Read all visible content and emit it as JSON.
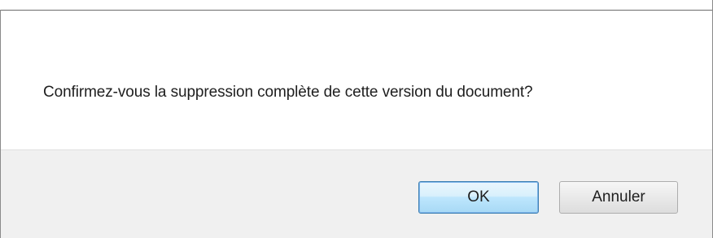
{
  "dialog": {
    "message": "Confirmez-vous la suppression complète de cette version du document?",
    "buttons": {
      "ok_label": "OK",
      "cancel_label": "Annuler"
    }
  },
  "colors": {
    "content_bg": "#ffffff",
    "footer_bg": "#f0f0f0",
    "default_button_border": "#3c7fb1"
  }
}
